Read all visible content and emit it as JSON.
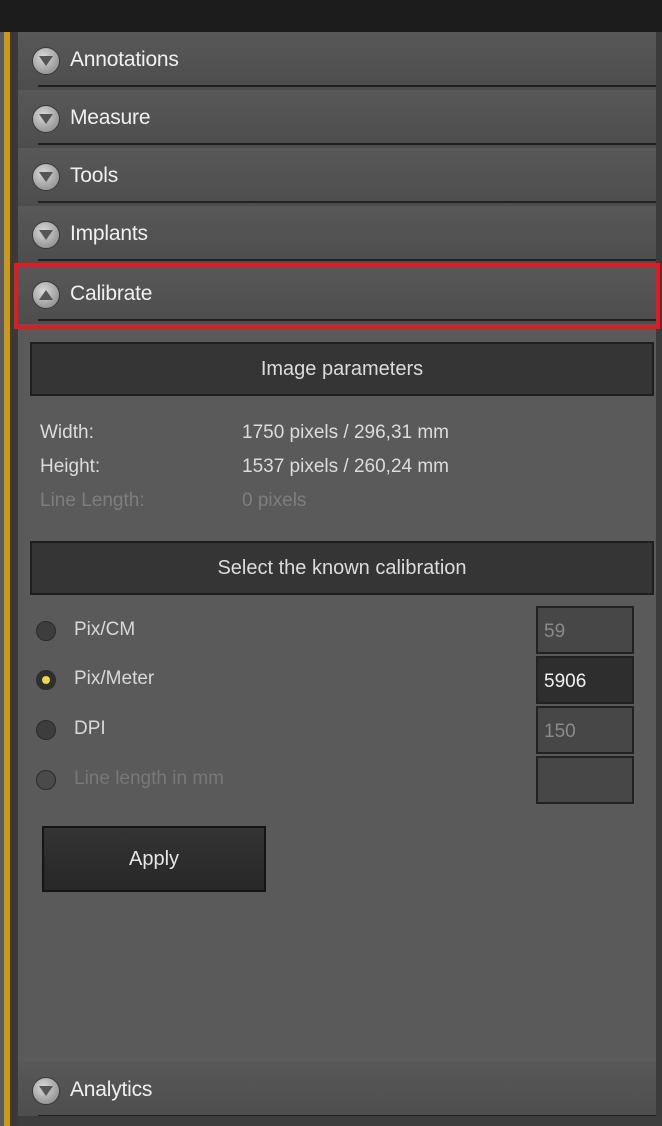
{
  "accordion": [
    {
      "label": "Annotations",
      "expanded": false
    },
    {
      "label": "Measure",
      "expanded": false
    },
    {
      "label": "Tools",
      "expanded": false
    },
    {
      "label": "Implants",
      "expanded": false
    },
    {
      "label": "Calibrate",
      "expanded": true
    },
    {
      "label": "Analytics",
      "expanded": false
    }
  ],
  "calibrate": {
    "image_parameters_title": "Image parameters",
    "width_label": "Width:",
    "width_value": "1750 pixels / 296,31 mm",
    "height_label": "Height:",
    "height_value": "1537 pixels / 260,24 mm",
    "line_length_label": "Line Length:",
    "line_length_value": "0 pixels",
    "select_title": "Select the known calibration",
    "options": [
      {
        "label": "Pix/CM",
        "value": "59",
        "checked": false,
        "enabled": true
      },
      {
        "label": "Pix/Meter",
        "value": "5906",
        "checked": true,
        "enabled": true
      },
      {
        "label": "DPI",
        "value": "150",
        "checked": false,
        "enabled": true
      },
      {
        "label": "Line length in mm",
        "value": "",
        "checked": false,
        "enabled": false
      }
    ],
    "apply_label": "Apply"
  },
  "colors": {
    "accent_left": "#c99a1a",
    "highlight": "#e21b23",
    "radio_selected": "#f2d64a"
  },
  "icons": {
    "collapsed": "chevron-down-icon",
    "expanded": "chevron-up-icon"
  }
}
